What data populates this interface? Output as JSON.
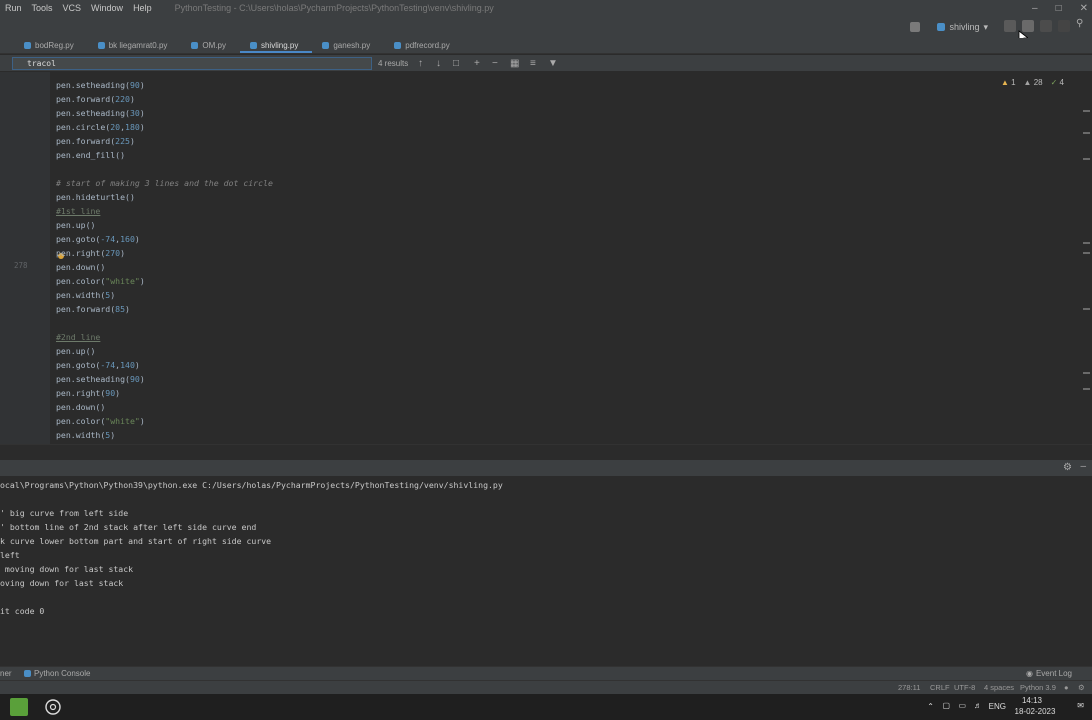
{
  "menubar": {
    "items": [
      "Run",
      "Tools",
      "VCS",
      "Window",
      "Help"
    ],
    "title": "PythonTesting - C:\\Users\\holas\\PycharmProjects\\PythonTesting\\venv\\shivling.py"
  },
  "toolbar": {
    "run_config": "shivling"
  },
  "tabs": [
    {
      "label": "bodReg.py",
      "active": false
    },
    {
      "label": "bk liegamrat0.py",
      "active": false
    },
    {
      "label": "OM.py",
      "active": false
    },
    {
      "label": "shivling.py",
      "active": true
    },
    {
      "label": "ganesh.py",
      "active": false
    },
    {
      "label": "pdfrecord.py",
      "active": false
    }
  ],
  "find": {
    "query": "tracol",
    "results": "4 results"
  },
  "editor": {
    "inspections": {
      "warnings": "1",
      "weak_warnings": "28",
      "typos": "4"
    },
    "current_line_number": "278",
    "lines": [
      [
        {
          "t": "pen.setheading("
        },
        {
          "t": "90",
          "c": "num"
        },
        {
          "t": ")"
        }
      ],
      [
        {
          "t": "pen.forward("
        },
        {
          "t": "220",
          "c": "num"
        },
        {
          "t": ")"
        }
      ],
      [
        {
          "t": "pen.setheading("
        },
        {
          "t": "30",
          "c": "num"
        },
        {
          "t": ")"
        }
      ],
      [
        {
          "t": "pen.circle("
        },
        {
          "t": "20",
          "c": "num"
        },
        {
          "t": ","
        },
        {
          "t": "180",
          "c": "num"
        },
        {
          "t": ")"
        }
      ],
      [
        {
          "t": "pen.forward("
        },
        {
          "t": "225",
          "c": "num"
        },
        {
          "t": ")"
        }
      ],
      [
        {
          "t": "pen.end_fill()"
        }
      ],
      [
        {
          "t": ""
        }
      ],
      [
        {
          "t": "# start of making 3 lines and the dot circle",
          "c": "comment"
        }
      ],
      [
        {
          "t": "pen.hideturtle()"
        }
      ],
      [
        {
          "t": "#1st line",
          "c": "underline"
        }
      ],
      [
        {
          "t": "pen.up()"
        }
      ],
      [
        {
          "t": "pen.goto("
        },
        {
          "t": "-74",
          "c": "num"
        },
        {
          "t": ","
        },
        {
          "t": "160",
          "c": "num"
        },
        {
          "t": ")"
        }
      ],
      [
        {
          "t": "pen.right("
        },
        {
          "t": "270",
          "c": "num"
        },
        {
          "t": ")"
        }
      ],
      [
        {
          "t": "pen.down()"
        }
      ],
      [
        {
          "t": "pen.color("
        },
        {
          "t": "\"white\"",
          "c": "str"
        },
        {
          "t": ")"
        }
      ],
      [
        {
          "t": "pen.width("
        },
        {
          "t": "5",
          "c": "num"
        },
        {
          "t": ")"
        }
      ],
      [
        {
          "t": "pen.forward("
        },
        {
          "t": "85",
          "c": "num"
        },
        {
          "t": ")"
        }
      ],
      [
        {
          "t": ""
        }
      ],
      [
        {
          "t": "#2nd line",
          "c": "underline"
        }
      ],
      [
        {
          "t": "pen.up()"
        }
      ],
      [
        {
          "t": "pen.goto("
        },
        {
          "t": "-74",
          "c": "num"
        },
        {
          "t": ","
        },
        {
          "t": "140",
          "c": "num"
        },
        {
          "t": ")"
        }
      ],
      [
        {
          "t": "pen.setheading("
        },
        {
          "t": "90",
          "c": "num"
        },
        {
          "t": ")"
        }
      ],
      [
        {
          "t": "pen.right("
        },
        {
          "t": "90",
          "c": "num"
        },
        {
          "t": ")"
        }
      ],
      [
        {
          "t": "pen.down()"
        }
      ],
      [
        {
          "t": "pen.color("
        },
        {
          "t": "\"white\"",
          "c": "str"
        },
        {
          "t": ")"
        }
      ],
      [
        {
          "t": "pen.width("
        },
        {
          "t": "5",
          "c": "num"
        },
        {
          "t": ")"
        }
      ]
    ]
  },
  "console": {
    "lines": [
      "ocal\\Programs\\Python\\Python39\\python.exe C:/Users/holas/PycharmProjects/PythonTesting/venv/shivling.py",
      "",
      "' big curve from left side",
      "' bottom line of 2nd stack after left side curve end",
      "k curve lower bottom part and start of right side curve",
      "left",
      " moving down for last stack",
      "oving down for last stack",
      "",
      "it code 0"
    ]
  },
  "toolwindows": {
    "left_label": "ner",
    "python_console": "Python Console",
    "event_log": "Event Log"
  },
  "status": {
    "position": "278:11",
    "line_sep": "CRLF",
    "encoding": "UTF-8",
    "indent": "4 spaces",
    "interpreter": "Python 3.9"
  },
  "taskbar": {
    "lang": "ENG",
    "time": "14:13",
    "date": "18-02-2023"
  }
}
